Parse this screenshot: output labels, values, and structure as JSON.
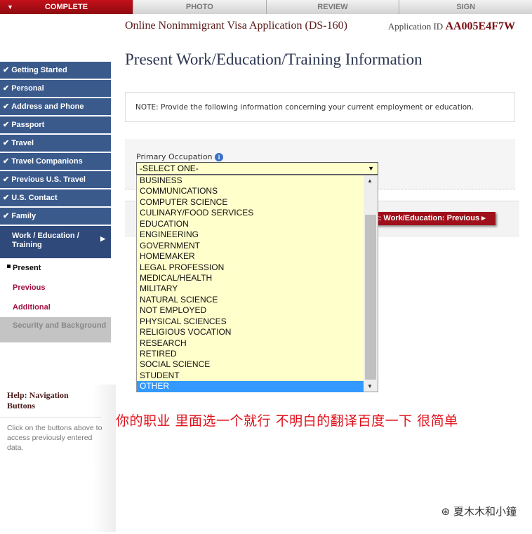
{
  "topbar": {
    "tabs": [
      "COMPLETE",
      "PHOTO",
      "REVIEW",
      "SIGN"
    ]
  },
  "header": {
    "title": "Online Nonimmigrant Visa Application (DS-160)",
    "app_id_label": "Application ID",
    "app_id": "AA005E4F7W"
  },
  "sidebar": {
    "items": [
      "Getting Started",
      "Personal",
      "Address and Phone",
      "Passport",
      "Travel",
      "Travel Companions",
      "Previous U.S. Travel",
      "U.S. Contact",
      "Family"
    ],
    "current": "Work / Education / Training",
    "subitems": [
      "Present",
      "Previous",
      "Additional"
    ],
    "disabled": "Security and Background"
  },
  "help": {
    "title": "Help: Navigation Buttons",
    "text": "Click on the buttons above to access previously entered data."
  },
  "main": {
    "title": "Present Work/Education/Training Information",
    "note": "NOTE: Provide the following information concerning your current employment or education.",
    "field_label": "Primary Occupation",
    "select_value": "-SELECT ONE-",
    "button": "t: Work/Education: Previous",
    "options": [
      "BUSINESS",
      "COMMUNICATIONS",
      "COMPUTER SCIENCE",
      "CULINARY/FOOD SERVICES",
      "EDUCATION",
      "ENGINEERING",
      "GOVERNMENT",
      "HOMEMAKER",
      "LEGAL PROFESSION",
      "MEDICAL/HEALTH",
      "MILITARY",
      "NATURAL SCIENCE",
      "NOT EMPLOYED",
      "PHYSICAL SCIENCES",
      "RELIGIOUS VOCATION",
      "RESEARCH",
      "RETIRED",
      "SOCIAL SCIENCE",
      "STUDENT",
      "OTHER"
    ],
    "highlighted": "OTHER"
  },
  "annotation": "你的职业  里面选一个就行  不明白的翻译百度一下  很简单",
  "watermark": "夏木木和小鐘"
}
